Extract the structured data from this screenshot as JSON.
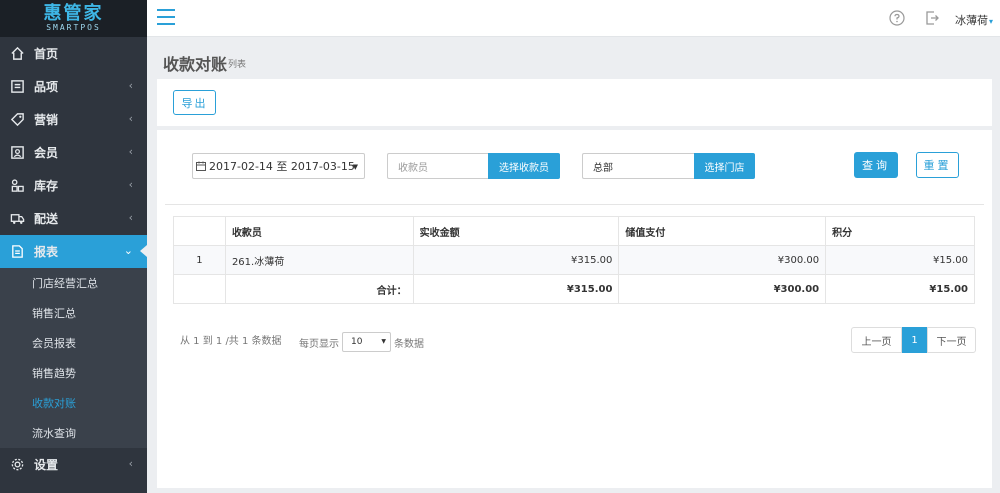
{
  "app": {
    "logo_main": "惠管家",
    "logo_sub": "SMARTPOS"
  },
  "sidebar": {
    "items": [
      {
        "label": "首页",
        "icon": "home-icon"
      },
      {
        "label": "品项",
        "icon": "list-icon",
        "chevron": "‹"
      },
      {
        "label": "营销",
        "icon": "tag-icon",
        "chevron": "‹"
      },
      {
        "label": "会员",
        "icon": "member-card-icon",
        "chevron": "‹"
      },
      {
        "label": "库存",
        "icon": "grid-icon",
        "chevron": "‹"
      },
      {
        "label": "配送",
        "icon": "truck-icon",
        "chevron": "‹"
      },
      {
        "label": "报表",
        "icon": "report-icon",
        "chevron": "⌄"
      }
    ],
    "sub_items": [
      "门店经营汇总",
      "销售汇总",
      "会员报表",
      "销售趋势",
      "收款对账",
      "流水查询"
    ],
    "bottom_items": [
      {
        "label": "设置",
        "icon": "gear-icon",
        "chevron": "‹"
      }
    ]
  },
  "header": {
    "user_name": "冰薄荷",
    "user_caret": "▾"
  },
  "page": {
    "title": "收款对账",
    "subtitle": "列表"
  },
  "toolbar": {
    "export_label": "导出"
  },
  "filters": {
    "date_range": "2017-02-14 至 2017-03-15",
    "cashier_placeholder": "收款员",
    "cashier_button": "选择收款员",
    "store_value": "总部",
    "store_button": "选择门店",
    "query_label": "查询",
    "reset_label": "重置"
  },
  "table": {
    "headers": [
      "",
      "收款员",
      "实收金额",
      "储值支付",
      "积分"
    ],
    "rows": [
      {
        "index": "1",
        "cashier": "261.冰薄荷",
        "received": "¥315.00",
        "stored": "¥300.00",
        "points": "¥15.00"
      }
    ],
    "total": {
      "label": "合计：",
      "received": "¥315.00",
      "stored": "¥300.00",
      "points": "¥15.00"
    }
  },
  "pagination": {
    "info": "从 1 到 1 /共 1 条数据",
    "per_page_prefix": "每页显示",
    "per_page_value": "10",
    "per_page_suffix": "条数据",
    "prev": "上一页",
    "current": "1",
    "next": "下一页"
  },
  "colors": {
    "accent": "#2aa0d8",
    "sidebar_bg": "#2f353e",
    "content_bg": "#eceef1"
  }
}
